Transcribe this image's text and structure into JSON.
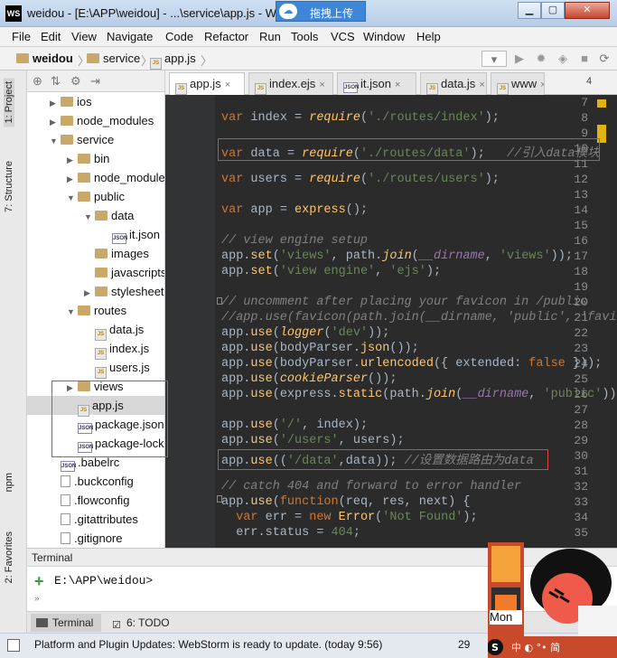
{
  "window": {
    "title": "weidou - [E:\\APP\\weidou] - ...\\service\\app.js - W",
    "logo": "WS",
    "upload_overlay": "拖拽上传"
  },
  "menu": [
    "File",
    "Edit",
    "View",
    "Navigate",
    "Code",
    "Refactor",
    "Run",
    "Tools",
    "VCS",
    "Window",
    "Help"
  ],
  "breadcrumb": [
    "weidou",
    "service",
    "app.js"
  ],
  "side_tabs": {
    "project": "1: Project",
    "structure": "7: Structure",
    "npm": "npm",
    "favorites": "2: Favorites"
  },
  "tree": [
    {
      "label": "ios",
      "type": "folder",
      "arrow": "▶",
      "depth": 1
    },
    {
      "label": "node_modules",
      "type": "folder",
      "arrow": "▶",
      "depth": 1
    },
    {
      "label": "service",
      "type": "folder",
      "arrow": "▼",
      "depth": 1
    },
    {
      "label": "bin",
      "type": "folder",
      "arrow": "▶",
      "depth": 2
    },
    {
      "label": "node_modules",
      "type": "folder",
      "arrow": "▶",
      "depth": 2
    },
    {
      "label": "public",
      "type": "folder",
      "arrow": "▼",
      "depth": 2
    },
    {
      "label": "data",
      "type": "folder",
      "arrow": "▼",
      "depth": 3
    },
    {
      "label": "it.json",
      "type": "json",
      "arrow": "",
      "depth": 4
    },
    {
      "label": "images",
      "type": "folder",
      "arrow": "",
      "depth": 3
    },
    {
      "label": "javascripts",
      "type": "folder",
      "arrow": "",
      "depth": 3
    },
    {
      "label": "stylesheets",
      "type": "folder",
      "arrow": "▶",
      "depth": 3
    },
    {
      "label": "routes",
      "type": "folder",
      "arrow": "▼",
      "depth": 2
    },
    {
      "label": "data.js",
      "type": "js",
      "arrow": "",
      "depth": 3
    },
    {
      "label": "index.js",
      "type": "js",
      "arrow": "",
      "depth": 3
    },
    {
      "label": "users.js",
      "type": "js",
      "arrow": "",
      "depth": 3
    },
    {
      "label": "views",
      "type": "folder",
      "arrow": "▶",
      "depth": 2
    },
    {
      "label": "app.js",
      "type": "js",
      "arrow": "",
      "depth": 2,
      "selected": true
    },
    {
      "label": "package.json",
      "type": "json",
      "arrow": "",
      "depth": 2
    },
    {
      "label": "package-lock",
      "type": "json",
      "arrow": "",
      "depth": 2
    },
    {
      "label": ".babelrc",
      "type": "json",
      "arrow": "",
      "depth": 1
    },
    {
      "label": ".buckconfig",
      "type": "file",
      "arrow": "",
      "depth": 1
    },
    {
      "label": ".flowconfig",
      "type": "file",
      "arrow": "",
      "depth": 1
    },
    {
      "label": ".gitattributes",
      "type": "file",
      "arrow": "",
      "depth": 1
    },
    {
      "label": ".gitignore",
      "type": "file",
      "arrow": "",
      "depth": 1
    }
  ],
  "tabs": [
    {
      "label": "app.js",
      "active": true
    },
    {
      "label": "index.ejs",
      "active": false
    },
    {
      "label": "it.json",
      "active": false
    },
    {
      "label": "data.js",
      "active": false
    },
    {
      "label": "www",
      "active": false
    }
  ],
  "tab_overflow": "4",
  "code_lines": [
    {
      "n": "7",
      "html": ""
    },
    {
      "n": "8",
      "html": "<span class=\"kw\">var</span> index = <span class=\"fn it\">require</span>(<span class=\"str\">'./routes/index'</span>);"
    },
    {
      "n": "9",
      "html": ""
    },
    {
      "n": "10",
      "html": "<span class=\"kw\">var</span> data = <span class=\"fn it\">require</span>(<span class=\"str\">'./routes/data'</span>);   <span class=\"cm\">//引入data模块</span>"
    },
    {
      "n": "11",
      "html": ""
    },
    {
      "n": "12",
      "html": "<span class=\"kw\">var</span> users = <span class=\"fn it\">require</span>(<span class=\"str\">'./routes/users'</span>);"
    },
    {
      "n": "13",
      "html": ""
    },
    {
      "n": "14",
      "html": "<span class=\"kw\">var</span> app = <span class=\"fn\">express</span>();"
    },
    {
      "n": "15",
      "html": ""
    },
    {
      "n": "16",
      "html": "<span class=\"cm\">// view engine setup</span>"
    },
    {
      "n": "17",
      "html": "app.<span class=\"fn\">set</span>(<span class=\"str\">'views'</span>, path.<span class=\"fn it\">join</span>(<span class=\"prm it\">__dirname</span>, <span class=\"str\">'views'</span>));"
    },
    {
      "n": "18",
      "html": "app.<span class=\"fn\">set</span>(<span class=\"str\">'view engine'</span>, <span class=\"str\">'ejs'</span>);"
    },
    {
      "n": "19",
      "html": ""
    },
    {
      "n": "20",
      "html": "<span class=\"cm\">// uncomment after placing your favicon in /public</span>"
    },
    {
      "n": "21",
      "html": "<span class=\"cm\">//app.use(favicon(path.join(__dirname, 'public', 'favi</span>"
    },
    {
      "n": "22",
      "html": "app.<span class=\"fn\">use</span>(<span class=\"fn it\">logger</span>(<span class=\"str\">'dev'</span>));"
    },
    {
      "n": "23",
      "html": "app.<span class=\"fn\">use</span>(bodyParser.<span class=\"fn\">json</span>());"
    },
    {
      "n": "24",
      "html": "app.<span class=\"fn\">use</span>(bodyParser.<span class=\"fn\">urlencoded</span>({ extended: <span class=\"kw\">false</span> }));"
    },
    {
      "n": "25",
      "html": "app.<span class=\"fn\">use</span>(<span class=\"fn it\">cookieParser</span>());"
    },
    {
      "n": "26",
      "html": "app.<span class=\"fn\">use</span>(express.<span class=\"fn\">static</span>(path.<span class=\"fn it\">join</span>(<span class=\"prm it\">__dirname</span>, <span class=\"str\">'public'</span>)));"
    },
    {
      "n": "27",
      "html": ""
    },
    {
      "n": "28",
      "html": "app.<span class=\"fn\">use</span>(<span class=\"str\">'/'</span>, index);"
    },
    {
      "n": "29",
      "html": "app.<span class=\"fn\">use</span>(<span class=\"str\">'/users'</span>, users);"
    },
    {
      "n": "30",
      "html": "app.<span class=\"fn\">use</span>((<span class=\"str\">'/data'</span>,data)); <span class=\"cm\">//设置数据路由为data</span>"
    },
    {
      "n": "31",
      "html": ""
    },
    {
      "n": "32",
      "html": "<span class=\"cm\">// catch 404 and forward to error handler</span>"
    },
    {
      "n": "33",
      "html": "app.<span class=\"fn\">use</span>(<span class=\"kw\">function</span>(req, res, next) {"
    },
    {
      "n": "34",
      "html": "  <span class=\"kw\">var</span> err = <span class=\"kw\">new</span> <span class=\"fn\">Error</span>(<span class=\"str\">'Not Found'</span>);"
    },
    {
      "n": "35",
      "html": "  err.status = <span class=\"str\">404</span>;"
    }
  ],
  "terminal": {
    "title": "Terminal",
    "prompt": "E:\\APP\\weidou>"
  },
  "bottom_tabs": {
    "terminal": "Terminal",
    "todo": "6: TODO"
  },
  "status": {
    "message": "Platform and Plugin Updates: WebStorm is ready to update. (today 9:56)",
    "position": "29",
    "overlay_word": "Mon"
  },
  "colors": {
    "accent": "#3f86d6",
    "editor_bg": "#2b2b2b",
    "highlight": "#e04343"
  }
}
